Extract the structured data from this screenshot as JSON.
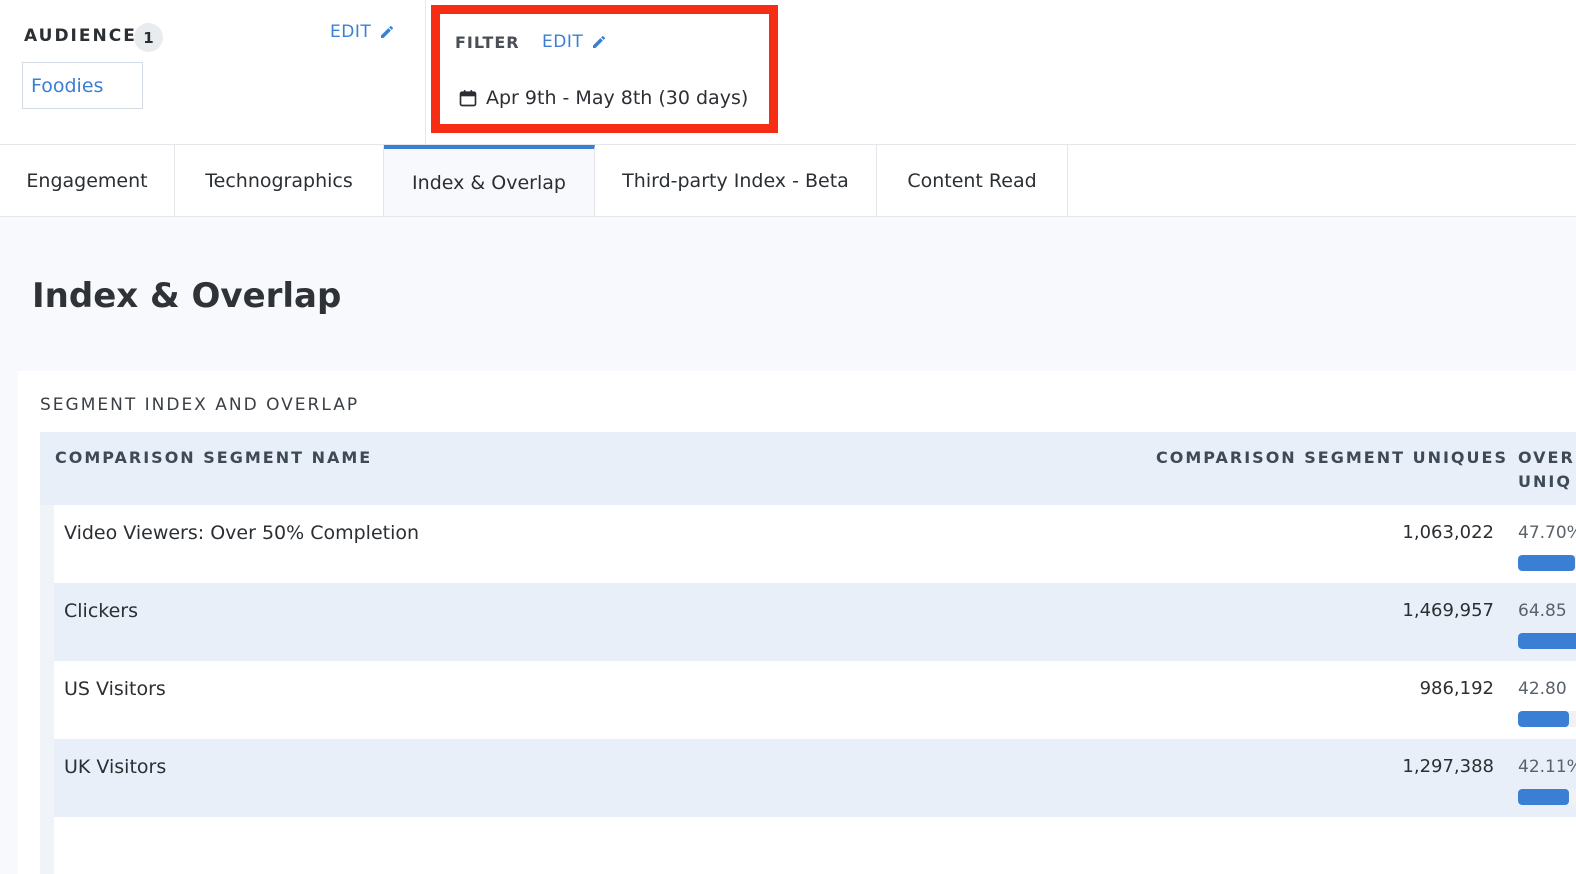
{
  "header": {
    "audience": {
      "label": "AUDIENCE",
      "count": "1",
      "edit_label": "EDIT",
      "chip": "Foodies"
    },
    "filter": {
      "label": "FILTER",
      "edit_label": "EDIT",
      "date_range": "Apr 9th - May 8th (30 days)"
    }
  },
  "tabs": [
    {
      "label": "Engagement",
      "active": false
    },
    {
      "label": "Technographics",
      "active": false
    },
    {
      "label": "Index & Overlap",
      "active": true
    },
    {
      "label": "Third-party Index - Beta",
      "active": false
    },
    {
      "label": "Content Read",
      "active": false
    }
  ],
  "page": {
    "title": "Index & Overlap",
    "card_title": "SEGMENT INDEX AND OVERLAP",
    "columns": {
      "name": "COMPARISON SEGMENT NAME",
      "uniques": "COMPARISON SEGMENT UNIQUES",
      "overlap": "OVER\nUNIQ"
    },
    "rows": [
      {
        "name": "Video Viewers: Over 50% Completion",
        "uniques": "1,063,022",
        "pct_text": "47.70%",
        "pct": 47.7
      },
      {
        "name": "Clickers",
        "uniques": "1,469,957",
        "pct_text": "64.85",
        "pct": 64.85
      },
      {
        "name": "US Visitors",
        "uniques": "986,192",
        "pct_text": "42.80",
        "pct": 42.8
      },
      {
        "name": "UK Visitors",
        "uniques": "1,297,388",
        "pct_text": "42.11%",
        "pct": 42.11
      }
    ]
  },
  "colors": {
    "accent": "#3b7fd4",
    "highlight_border": "#f62d14",
    "row_alt": "#e8eff8"
  }
}
